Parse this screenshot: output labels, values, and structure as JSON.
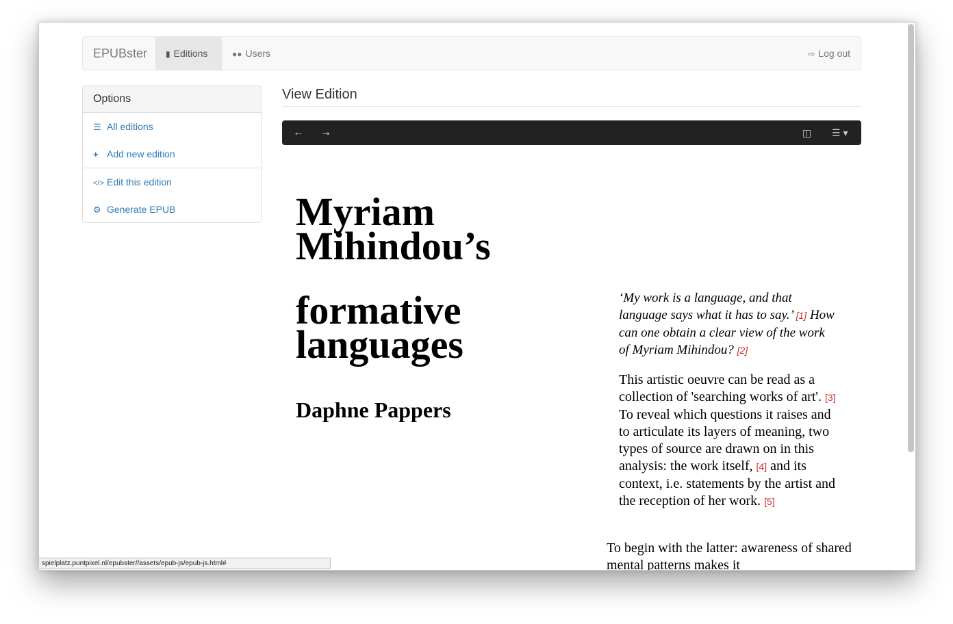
{
  "navbar": {
    "brand": "EPUBster",
    "items": [
      {
        "label": "Editions",
        "icon": "book-icon"
      },
      {
        "label": "Users",
        "icon": "users-icon"
      }
    ],
    "logout": {
      "label": "Log out",
      "icon": "sign-out-icon"
    }
  },
  "sidebar": {
    "heading": "Options",
    "items": [
      {
        "label": "All editions",
        "icon": "list-icon"
      },
      {
        "label": "Add new edition",
        "icon": "plus-icon"
      },
      {
        "label": "Edit this edition",
        "icon": "code-icon"
      },
      {
        "label": "Generate EPUB",
        "icon": "gears-icon"
      }
    ]
  },
  "main": {
    "title": "View Edition"
  },
  "book": {
    "title_line1": "Myriam Mihindou’s",
    "title_line2": "formative languages",
    "author": "Daphne Pappers",
    "quote": "‘My work is a language, and that language says what it has to say.’",
    "fn1": "[1]",
    "question": "How can one obtain a clear view of the work of Myriam Mihindou?",
    "fn2": "[2]",
    "para1a": "This artistic oeuvre can be read as a collection of 'searching works of art'.",
    "fn3": "[3]",
    "para1b": "To reveal which questions it raises and to articulate its layers of meaning, two types of source are drawn on in this analysis: the work itself,",
    "fn4": "[4]",
    "para1c": "and its context, i.e. statements by the artist and the reception of her work.",
    "fn5": "[5]",
    "para2": "To begin with the latter: awareness of shared mental patterns makes it"
  },
  "status_url": "spielplatz.puntpixel.nl/epubster//assets/epub-js/epub-js.html#"
}
